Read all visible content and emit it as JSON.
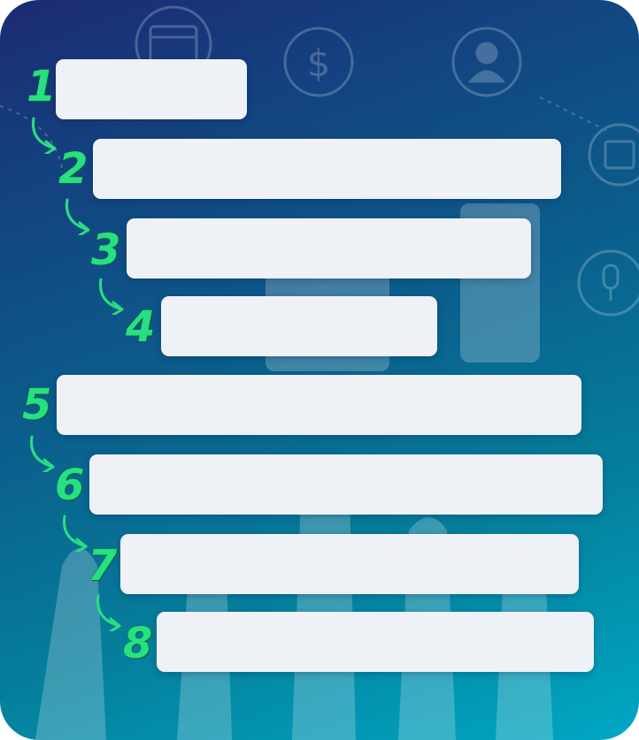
{
  "steps": [
    {
      "number": "1",
      "text": ""
    },
    {
      "number": "2",
      "text": ""
    },
    {
      "number": "3",
      "text": ""
    },
    {
      "number": "4",
      "text": ""
    },
    {
      "number": "5",
      "text": ""
    },
    {
      "number": "6",
      "text": ""
    },
    {
      "number": "7",
      "text": ""
    },
    {
      "number": "8",
      "text": ""
    }
  ],
  "colors": {
    "number": "#27e07f",
    "box": "#eef1f6",
    "background_top": "#1d2a72",
    "background_bottom": "#00a8c4"
  },
  "icons": [
    "calendar-icon",
    "dollar-icon",
    "user-icon",
    "microphone-icon"
  ]
}
